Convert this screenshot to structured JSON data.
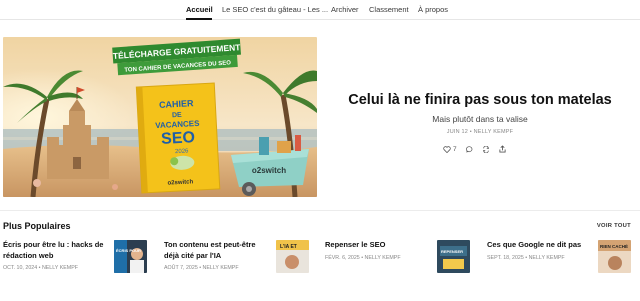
{
  "nav": {
    "items": [
      {
        "label": "Accueil",
        "active": true
      },
      {
        "label": "Le SEO c'est du gâteau - Les ...",
        "active": false
      },
      {
        "label": "Archiver",
        "active": false
      },
      {
        "label": "Classement",
        "active": false
      },
      {
        "label": "À propos",
        "active": false
      }
    ]
  },
  "hero": {
    "image": {
      "banner_line1": "TÉLÉCHARGE GRATUITEMENT",
      "banner_line2": "TON CAHIER DE VACANCES DU SEO",
      "book_title1": "CAHIER",
      "book_title2": "DE",
      "book_title3": "VACANCES",
      "book_title4": "SEO",
      "book_year": "2026",
      "brand": "o2switch"
    },
    "title": "Celui là ne finira pas sous ton matelas",
    "subtitle": "Mais plutôt dans ta valise",
    "meta": "JUIN 12 • NELLY KEMPF",
    "likes": "7"
  },
  "popular": {
    "heading": "Plus Populaires",
    "see_all": "VOIR TOUT",
    "cards": [
      {
        "title": "Écris pour être lu : hacks de rédaction web",
        "meta": "OCT. 10, 2024 • NELLY KEMPF",
        "thumb_text": "ÉCRIS POUR"
      },
      {
        "title": "Ton contenu est peut-être déjà cité par l'IA",
        "meta": "AOÛT 7, 2025 • NELLY KEMPF",
        "thumb_text": "L'IA ET"
      },
      {
        "title": "Repenser le SEO",
        "meta": "FÉVR. 6, 2025 • NELLY KEMPF",
        "thumb_text": "REPENSER"
      },
      {
        "title": "Ces que Google ne dit pas",
        "meta": "SEPT. 18, 2025 • NELLY KEMPF",
        "thumb_text": "RIEN CACHÉ"
      }
    ]
  },
  "colors": {
    "accent": "#111111",
    "banner_green": "#2f8a2f",
    "book_yellow": "#f4c21a",
    "sky_top": "#f1d6a8",
    "sea": "#9ab7c4"
  }
}
